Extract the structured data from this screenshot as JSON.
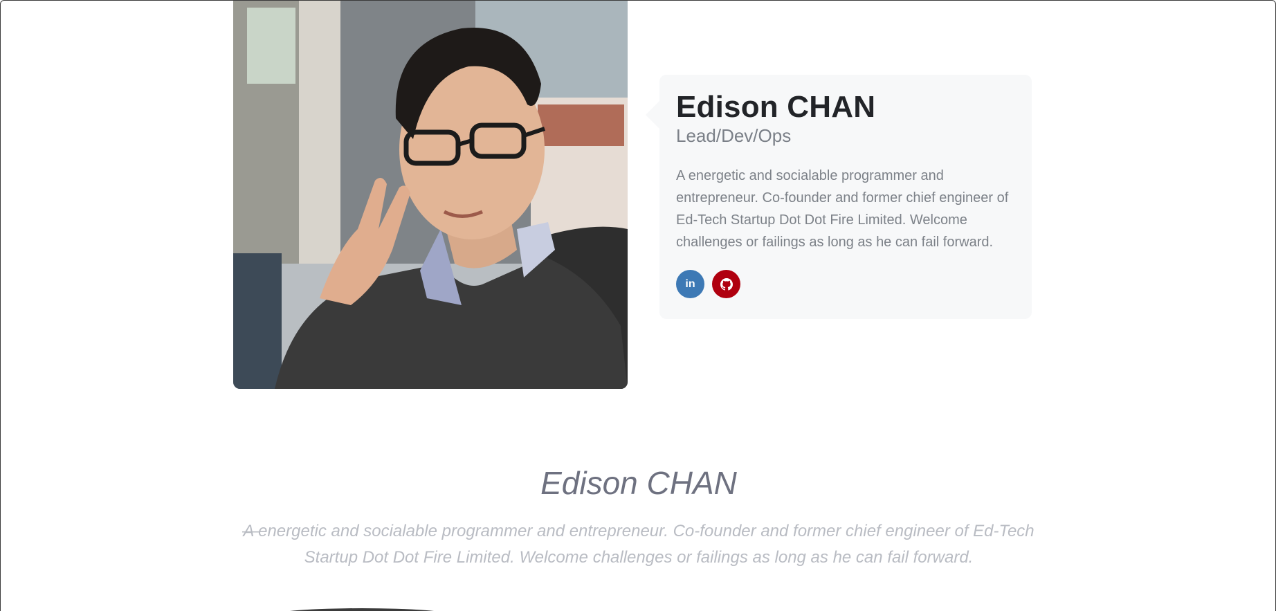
{
  "profile": {
    "name": "Edison CHAN",
    "role": "Lead/Dev/Ops",
    "bio": "A energetic and socialable programmer and entrepreneur. Co-founder and former chief engineer of Ed-Tech Startup Dot Dot Fire Limited. Welcome challenges or failings as long as he can fail forward.",
    "photo_icon": "portrait-photo",
    "socials": [
      {
        "icon": "linkedin-icon",
        "glyph": "in",
        "color": "#3d79b5"
      },
      {
        "icon": "github-icon",
        "glyph": "⌾",
        "color": "#b0000f"
      }
    ]
  },
  "quote": {
    "name": "Edison CHAN",
    "dash": "—",
    "text": "A energetic and socialable programmer and entrepreneur. Co-founder and former chief engineer of Ed-Tech Startup Dot Dot Fire Limited. Welcome challenges or failings as long as he can fail forward."
  }
}
